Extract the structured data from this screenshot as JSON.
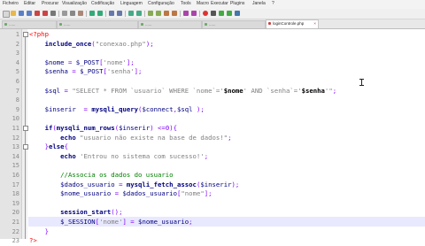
{
  "menu": [
    "Ficheiro",
    "Editar",
    "Procurar",
    "Visualização",
    "Codificação",
    "Linguagem",
    "Configuração",
    "Tools",
    "Macro",
    "Executar",
    "Plugins",
    "Janela",
    "?"
  ],
  "tabs": [
    {
      "label": "......"
    },
    {
      "label": "......"
    },
    {
      "label": "......"
    },
    {
      "label": "......"
    },
    {
      "label": "loginControle.php"
    }
  ],
  "lines": [
    {
      "n": "1",
      "segs": [
        {
          "t": "<?php",
          "c": "php"
        }
      ]
    },
    {
      "n": "2",
      "segs": [
        {
          "t": "    ",
          "c": ""
        },
        {
          "t": "include_once",
          "c": "fn"
        },
        {
          "t": "(",
          "c": "op"
        },
        {
          "t": "\"conexao.php\"",
          "c": "str"
        },
        {
          "t": ");",
          "c": "op"
        }
      ]
    },
    {
      "n": "3",
      "segs": []
    },
    {
      "n": "4",
      "segs": [
        {
          "t": "    ",
          "c": ""
        },
        {
          "t": "$nome",
          "c": "var"
        },
        {
          "t": " = ",
          "c": "op"
        },
        {
          "t": "$_POST",
          "c": "var"
        },
        {
          "t": "[",
          "c": "op"
        },
        {
          "t": "'nome'",
          "c": "str"
        },
        {
          "t": "];",
          "c": "op"
        }
      ]
    },
    {
      "n": "5",
      "segs": [
        {
          "t": "    ",
          "c": ""
        },
        {
          "t": "$senha",
          "c": "var"
        },
        {
          "t": " = ",
          "c": "op"
        },
        {
          "t": "$_POST",
          "c": "var"
        },
        {
          "t": "[",
          "c": "op"
        },
        {
          "t": "'senha'",
          "c": "str"
        },
        {
          "t": "];",
          "c": "op"
        }
      ]
    },
    {
      "n": "6",
      "segs": []
    },
    {
      "n": "7",
      "segs": [
        {
          "t": "    ",
          "c": ""
        },
        {
          "t": "$sql",
          "c": "var"
        },
        {
          "t": " = ",
          "c": "op"
        },
        {
          "t": "\"SELECT * FROM `usuario` WHERE `nome`='",
          "c": "str"
        },
        {
          "t": "$nome",
          "c": "svar"
        },
        {
          "t": "' AND `senha`='",
          "c": "str"
        },
        {
          "t": "$senha",
          "c": "svar"
        },
        {
          "t": "'\"",
          "c": "str"
        },
        {
          "t": ";",
          "c": "op"
        }
      ]
    },
    {
      "n": "8",
      "segs": []
    },
    {
      "n": "9",
      "segs": [
        {
          "t": "    ",
          "c": ""
        },
        {
          "t": "$inserir",
          "c": "var"
        },
        {
          "t": "  = ",
          "c": "op"
        },
        {
          "t": "mysqli_query",
          "c": "fn"
        },
        {
          "t": "(",
          "c": "op"
        },
        {
          "t": "$connect",
          "c": "var"
        },
        {
          "t": ",",
          "c": "op"
        },
        {
          "t": "$sql",
          "c": "var"
        },
        {
          "t": " );",
          "c": "op"
        }
      ]
    },
    {
      "n": "10",
      "segs": []
    },
    {
      "n": "11",
      "segs": [
        {
          "t": "    ",
          "c": ""
        },
        {
          "t": "if",
          "c": "kw"
        },
        {
          "t": "(",
          "c": "op"
        },
        {
          "t": "mysqli_num_rows",
          "c": "fn"
        },
        {
          "t": "(",
          "c": "op"
        },
        {
          "t": "$inserir",
          "c": "var"
        },
        {
          "t": ") <=0){",
          "c": "op"
        }
      ]
    },
    {
      "n": "12",
      "segs": [
        {
          "t": "        ",
          "c": ""
        },
        {
          "t": "echo",
          "c": "kw"
        },
        {
          "t": " ",
          "c": ""
        },
        {
          "t": "\"usuario não existe na base de dados!\"",
          "c": "str"
        },
        {
          "t": ";",
          "c": "op"
        }
      ]
    },
    {
      "n": "13",
      "segs": [
        {
          "t": "    ",
          "c": ""
        },
        {
          "t": "}",
          "c": "op"
        },
        {
          "t": "else",
          "c": "kw"
        },
        {
          "t": "{",
          "c": "op"
        }
      ]
    },
    {
      "n": "14",
      "segs": [
        {
          "t": "        ",
          "c": ""
        },
        {
          "t": "echo",
          "c": "kw"
        },
        {
          "t": " ",
          "c": ""
        },
        {
          "t": "'Entrou no sistema com sucesso!'",
          "c": "str"
        },
        {
          "t": ";",
          "c": "op"
        }
      ]
    },
    {
      "n": "15",
      "segs": []
    },
    {
      "n": "16",
      "segs": [
        {
          "t": "        ",
          "c": ""
        },
        {
          "t": "//Associa os dados do usuario",
          "c": "com"
        }
      ]
    },
    {
      "n": "17",
      "segs": [
        {
          "t": "        ",
          "c": ""
        },
        {
          "t": "$dados_usuario",
          "c": "var"
        },
        {
          "t": " = ",
          "c": "op"
        },
        {
          "t": "mysqli_fetch_assoc",
          "c": "fn"
        },
        {
          "t": "(",
          "c": "op"
        },
        {
          "t": "$inserir",
          "c": "var"
        },
        {
          "t": ");",
          "c": "op"
        }
      ]
    },
    {
      "n": "18",
      "segs": [
        {
          "t": "        ",
          "c": ""
        },
        {
          "t": "$nome_usuario",
          "c": "var"
        },
        {
          "t": " = ",
          "c": "op"
        },
        {
          "t": "$dados_usuario",
          "c": "var"
        },
        {
          "t": "[",
          "c": "op"
        },
        {
          "t": "\"nome\"",
          "c": "str"
        },
        {
          "t": "];",
          "c": "op"
        }
      ]
    },
    {
      "n": "19",
      "segs": []
    },
    {
      "n": "20",
      "segs": [
        {
          "t": "        ",
          "c": ""
        },
        {
          "t": "session_start",
          "c": "fn"
        },
        {
          "t": "();",
          "c": "op"
        }
      ]
    },
    {
      "n": "21",
      "segs": [
        {
          "t": "        ",
          "c": ""
        },
        {
          "t": "$_SESSION",
          "c": "var"
        },
        {
          "t": "[",
          "c": "op"
        },
        {
          "t": "'nome'",
          "c": "str"
        },
        {
          "t": "] = ",
          "c": "op"
        },
        {
          "t": "$nome_usuario",
          "c": "var"
        },
        {
          "t": ";",
          "c": "op"
        }
      ]
    },
    {
      "n": "22",
      "segs": [
        {
          "t": "    ",
          "c": ""
        },
        {
          "t": "}",
          "c": "op"
        }
      ]
    },
    {
      "n": "23",
      "segs": [
        {
          "t": "?>",
          "c": "php"
        }
      ]
    }
  ]
}
